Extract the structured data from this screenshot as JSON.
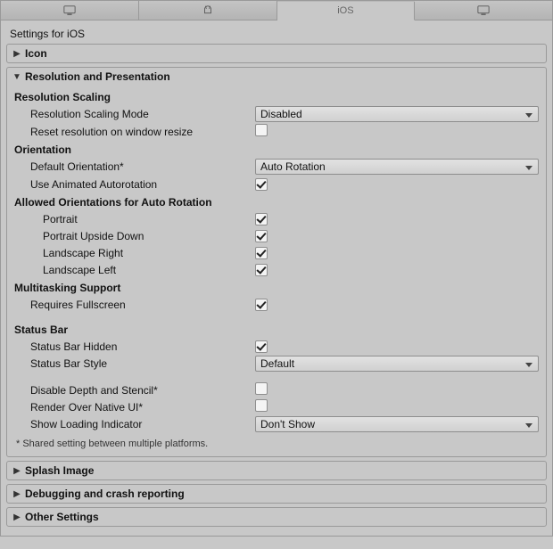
{
  "subtitle": "Settings for iOS",
  "tabs": {
    "active_index": 2,
    "ios_label": "iOS"
  },
  "sections": {
    "icon": {
      "title": "Icon",
      "expanded": false
    },
    "res_pres": {
      "title": "Resolution and Presentation",
      "expanded": true
    },
    "splash": {
      "title": "Splash Image",
      "expanded": false
    },
    "debug": {
      "title": "Debugging and crash reporting",
      "expanded": false
    },
    "other": {
      "title": "Other Settings",
      "expanded": false
    }
  },
  "res": {
    "scaling_header": "Resolution Scaling",
    "scaling_mode_label": "Resolution Scaling Mode",
    "scaling_mode_value": "Disabled",
    "reset_label": "Reset resolution on window resize",
    "reset_checked": false,
    "orientation_header": "Orientation",
    "default_orientation_label": "Default Orientation*",
    "default_orientation_value": "Auto Rotation",
    "use_anim_label": "Use Animated Autorotation",
    "use_anim_checked": true,
    "allowed_header": "Allowed Orientations for Auto Rotation",
    "portrait_label": "Portrait",
    "portrait_checked": true,
    "portrait_ud_label": "Portrait Upside Down",
    "portrait_ud_checked": true,
    "land_r_label": "Landscape Right",
    "land_r_checked": true,
    "land_l_label": "Landscape Left",
    "land_l_checked": true,
    "multitask_header": "Multitasking Support",
    "req_full_label": "Requires Fullscreen",
    "req_full_checked": true,
    "statusbar_header": "Status Bar",
    "sb_hidden_label": "Status Bar Hidden",
    "sb_hidden_checked": true,
    "sb_style_label": "Status Bar Style",
    "sb_style_value": "Default",
    "disable_depth_label": "Disable Depth and Stencil*",
    "disable_depth_checked": false,
    "render_native_label": "Render Over Native UI*",
    "render_native_checked": false,
    "loading_label": "Show Loading Indicator",
    "loading_value": "Don't Show",
    "footnote": "* Shared setting between multiple platforms."
  }
}
